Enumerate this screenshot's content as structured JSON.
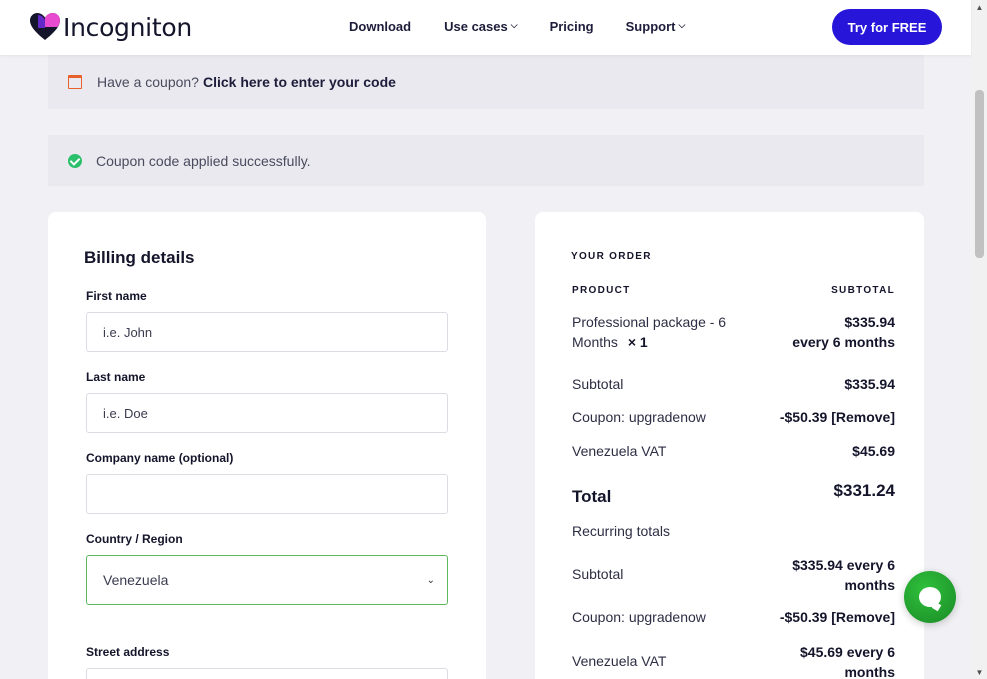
{
  "header": {
    "brand": "Incogniton",
    "nav": [
      "Download",
      "Use cases",
      "Pricing",
      "Support"
    ],
    "cta": "Try for FREE",
    "brand_color": "#2716d9"
  },
  "notices": {
    "coupon_prefix": "Have a coupon?",
    "coupon_link": "Click here to enter your code",
    "applied": "Coupon code applied successfully."
  },
  "billing": {
    "title": "Billing details",
    "first_name_label": "First name",
    "first_name_placeholder": "i.e. John",
    "last_name_label": "Last name",
    "last_name_placeholder": "i.e. Doe",
    "company_label": "Company name (optional)",
    "company_value": "",
    "country_label": "Country / Region",
    "country_value": "Venezuela",
    "street_label": "Street address"
  },
  "order": {
    "heading": "YOUR ORDER",
    "col_product": "PRODUCT",
    "col_subtotal": "SUBTOTAL",
    "product_name": "Professional package - 6 Months",
    "product_qty": "× 1",
    "product_price": "$335.94",
    "product_period": "every 6 months",
    "subtotal_label": "Subtotal",
    "subtotal_value": "$335.94",
    "coupon_label": "Coupon: upgradenow",
    "coupon_value": "-$50.39 [Remove]",
    "vat_label": "Venezuela VAT",
    "vat_value": "$45.69",
    "total_label": "Total",
    "total_value": "$331.24",
    "recurring_label": "Recurring totals",
    "rec_subtotal_label": "Subtotal",
    "rec_subtotal_value": "$335.94 every 6",
    "rec_subtotal_value2": "months",
    "rec_coupon_label": "Coupon: upgradenow",
    "rec_coupon_value": "-$50.39 [Remove]",
    "rec_vat_label": "Venezuela VAT",
    "rec_vat_value": "$45.69 every 6",
    "rec_vat_value2": "months"
  },
  "icons": {
    "logo": "heart-logo-icon",
    "coupon": "calendar-icon",
    "applied": "check-circle-icon",
    "chat": "chat-icon"
  }
}
